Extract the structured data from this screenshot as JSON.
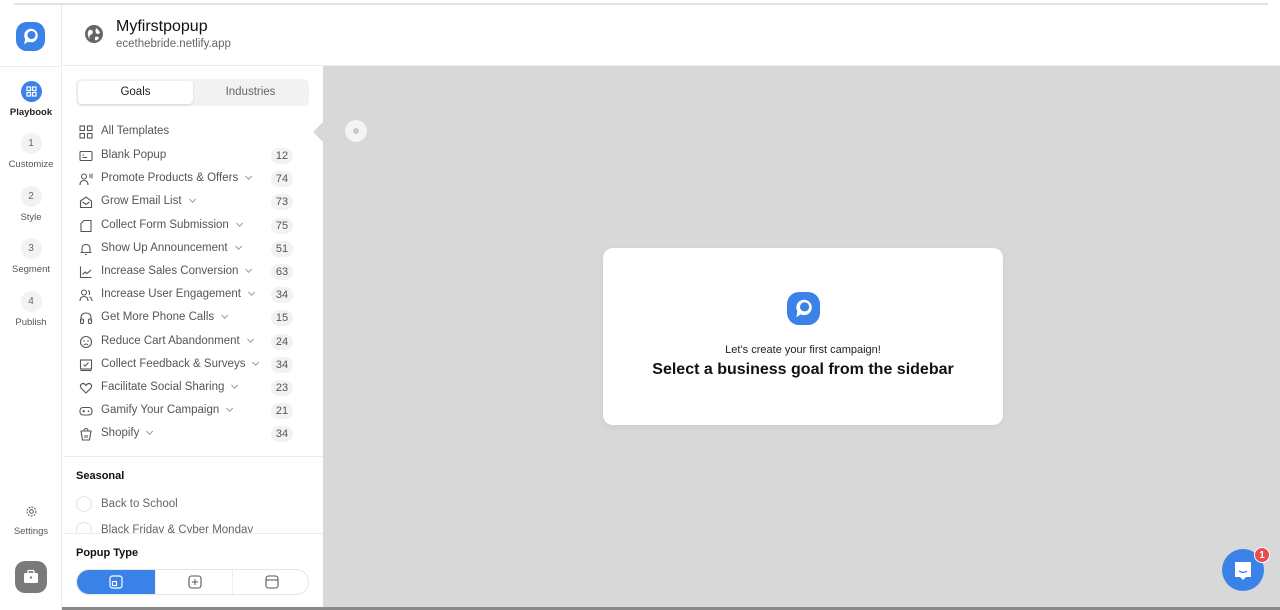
{
  "header": {
    "title": "Myfirstpopup",
    "subtitle": "ecethebride.netlify.app",
    "icon": "globe-icon"
  },
  "rail": {
    "items": [
      {
        "step": "",
        "label": "Playbook",
        "icon": "grid-icon",
        "active": true
      },
      {
        "step": "1",
        "label": "Customize",
        "active": false
      },
      {
        "step": "2",
        "label": "Style",
        "active": false
      },
      {
        "step": "3",
        "label": "Segment",
        "active": false
      },
      {
        "step": "4",
        "label": "Publish",
        "active": false
      }
    ],
    "settings_label": "Settings"
  },
  "sidebar": {
    "tabs": [
      {
        "label": "Goals",
        "active": true
      },
      {
        "label": "Industries",
        "active": false
      }
    ],
    "all_templates": "All Templates",
    "goals": [
      {
        "label": "Blank Popup",
        "count": "12",
        "icon": "blank-popup-icon",
        "expandable": false
      },
      {
        "label": "Promote Products & Offers",
        "count": "74",
        "icon": "promote-icon",
        "expandable": true
      },
      {
        "label": "Grow Email List",
        "count": "73",
        "icon": "email-icon",
        "expandable": true
      },
      {
        "label": "Collect Form Submission",
        "count": "75",
        "icon": "form-icon",
        "expandable": true
      },
      {
        "label": "Show Up Announcement",
        "count": "51",
        "icon": "bell-icon",
        "expandable": true
      },
      {
        "label": "Increase Sales Conversion",
        "count": "63",
        "icon": "chart-icon",
        "expandable": true
      },
      {
        "label": "Increase User Engagement",
        "count": "34",
        "icon": "users-icon",
        "expandable": true
      },
      {
        "label": "Get More Phone Calls",
        "count": "15",
        "icon": "headphones-icon",
        "expandable": true
      },
      {
        "label": "Reduce Cart Abandonment",
        "count": "24",
        "icon": "sad-face-icon",
        "expandable": true
      },
      {
        "label": "Collect Feedback & Surveys",
        "count": "34",
        "icon": "feedback-icon",
        "expandable": true
      },
      {
        "label": "Facilitate Social Sharing",
        "count": "23",
        "icon": "heart-icon",
        "expandable": true
      },
      {
        "label": "Gamify Your Campaign",
        "count": "21",
        "icon": "gamepad-icon",
        "expandable": true
      },
      {
        "label": "Shopify",
        "count": "34",
        "icon": "shopify-icon",
        "expandable": true
      }
    ],
    "seasonal_heading": "Seasonal",
    "seasonal": [
      {
        "label": "Back to School"
      },
      {
        "label": "Black Friday & Cyber Monday"
      }
    ],
    "popup_type_heading": "Popup Type",
    "popup_types": [
      {
        "name": "popup",
        "active": true
      },
      {
        "name": "floating",
        "active": false
      },
      {
        "name": "bar",
        "active": false
      }
    ]
  },
  "canvas": {
    "card_line1": "Let’s create your first campaign!",
    "card_line2": "Select a business goal from the sidebar"
  },
  "chat": {
    "badge": "1"
  },
  "colors": {
    "accent": "#3b82e8",
    "canvas_bg": "#d8d8d8",
    "badge": "#e84c4c"
  }
}
